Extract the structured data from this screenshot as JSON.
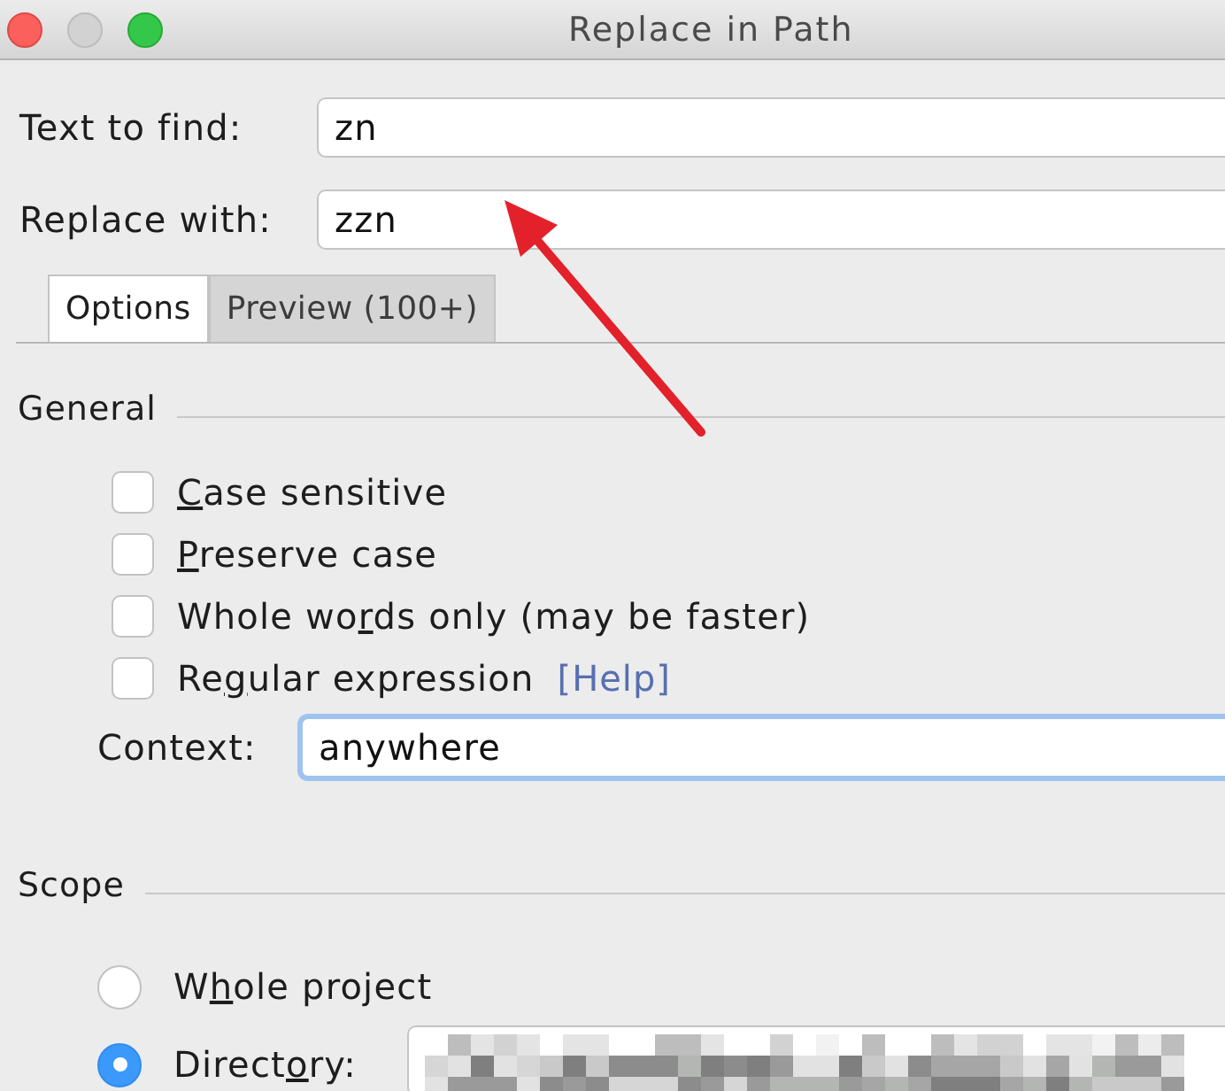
{
  "window": {
    "title": "Replace in Path"
  },
  "fields": [
    {
      "label": "Text to find:",
      "value": "zn"
    },
    {
      "label": "Replace with:",
      "value": "zzn"
    }
  ],
  "tabs": [
    {
      "label": "Options",
      "selected": true
    },
    {
      "label": "Preview (100+)",
      "selected": false
    }
  ],
  "general": {
    "title": "General",
    "options": [
      {
        "mnemonic": "C",
        "after": "ase sensitive",
        "checked": false
      },
      {
        "mnemonic": "P",
        "after": "reserve case",
        "checked": false
      },
      {
        "before": "Whole wo",
        "mnemonic": "r",
        "after": "ds only (may be faster)",
        "checked": false
      },
      {
        "before": "Re",
        "mnemonic": "g",
        "after": "ular expression",
        "checked": false,
        "link": "[Help]"
      }
    ],
    "context": {
      "label": "Context:",
      "value": "anywhere",
      "focused": true
    }
  },
  "scope": {
    "title": "Scope",
    "options": [
      {
        "kind": "plain",
        "before": "W",
        "mnemonic": "h",
        "after": "ole project",
        "selected": false
      },
      {
        "kind": "with_field",
        "before": "Direct",
        "mnemonic": "o",
        "after": "ry:",
        "selected": true
      }
    ]
  }
}
